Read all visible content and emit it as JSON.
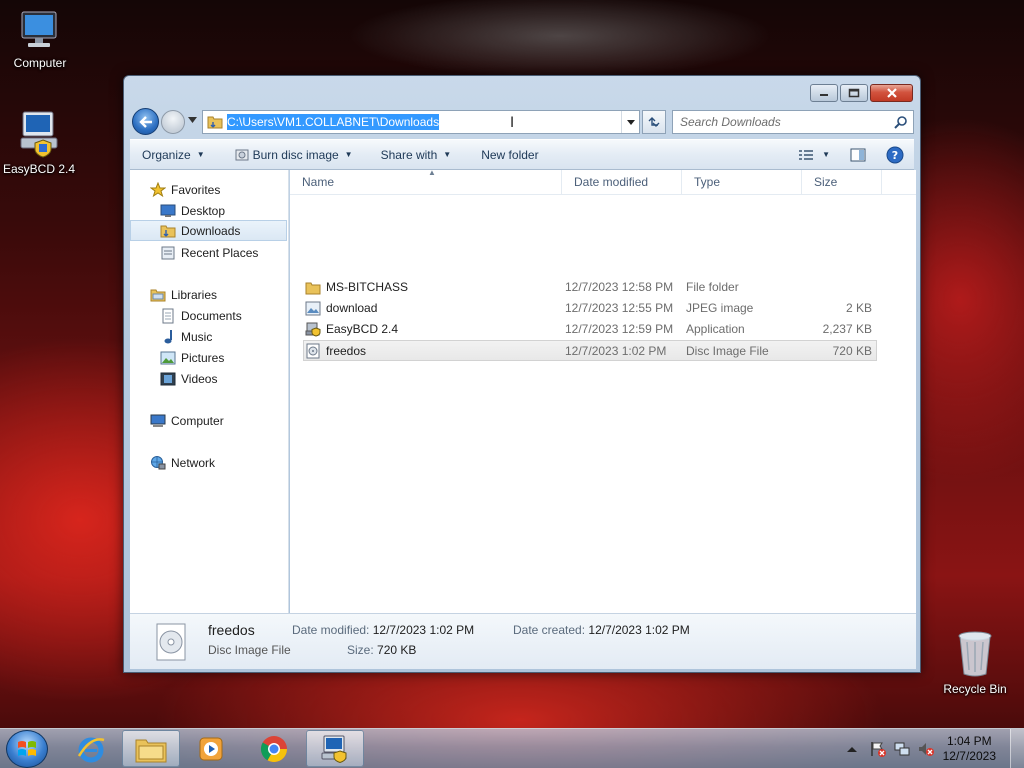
{
  "desktop": {
    "icons": [
      {
        "label": "Computer",
        "icon": "computer-icon"
      },
      {
        "label": "EasyBCD 2.4",
        "icon": "easybcd-icon"
      },
      {
        "label": "Recycle Bin",
        "icon": "recycle-bin-icon"
      }
    ]
  },
  "explorer": {
    "address": "C:\\Users\\VM1.COLLABNET\\Downloads",
    "search_placeholder": "Search Downloads",
    "toolbar": {
      "organize": "Organize",
      "burn": "Burn disc image",
      "share": "Share with",
      "new_folder": "New folder"
    },
    "nav": {
      "favorites": "Favorites",
      "desktop": "Desktop",
      "downloads": "Downloads",
      "recent": "Recent Places",
      "libraries": "Libraries",
      "documents": "Documents",
      "music": "Music",
      "pictures": "Pictures",
      "videos": "Videos",
      "computer": "Computer",
      "network": "Network"
    },
    "columns": {
      "name": "Name",
      "date": "Date modified",
      "type": "Type",
      "size": "Size"
    },
    "files": [
      {
        "name": "MS-BITCHASS",
        "date": "12/7/2023 12:58 PM",
        "type": "File folder",
        "size": "",
        "icon": "folder-icon"
      },
      {
        "name": "download",
        "date": "12/7/2023 12:55 PM",
        "type": "JPEG image",
        "size": "2 KB",
        "icon": "image-file-icon"
      },
      {
        "name": "EasyBCD 2.4",
        "date": "12/7/2023 12:59 PM",
        "type": "Application",
        "size": "2,237 KB",
        "icon": "installer-icon"
      },
      {
        "name": "freedos",
        "date": "12/7/2023 1:02 PM",
        "type": "Disc Image File",
        "size": "720 KB",
        "icon": "disc-image-icon"
      }
    ],
    "details": {
      "name": "freedos",
      "type": "Disc Image File",
      "date_modified_label": "Date modified:",
      "date_modified": "12/7/2023 1:02 PM",
      "size_label": "Size:",
      "size": "720 KB",
      "date_created_label": "Date created:",
      "date_created": "12/7/2023 1:02 PM"
    }
  },
  "taskbar": {
    "time": "1:04 PM",
    "date": "12/7/2023"
  },
  "colors": {
    "selection": "#3399ff",
    "link_text": "#1e3957"
  }
}
